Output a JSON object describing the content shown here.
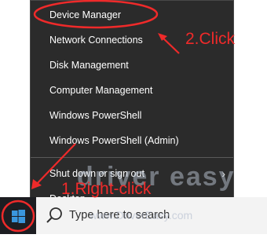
{
  "menu": {
    "items": [
      {
        "label": "Device Manager"
      },
      {
        "label": "Network Connections"
      },
      {
        "label": "Disk Management"
      },
      {
        "label": "Computer Management"
      },
      {
        "label": "Windows PowerShell"
      },
      {
        "label": "Windows PowerShell (Admin)"
      },
      {
        "label": "Shut down or sign out"
      },
      {
        "label": "Desktop"
      }
    ]
  },
  "taskbar": {
    "search_placeholder": "Type here to search",
    "start_icon": "windows-logo-icon",
    "search_icon": "search-icon"
  },
  "annotations": {
    "step1": "1.Right-click",
    "step2": "2.Click",
    "color": "#ef2a2a"
  },
  "watermark": {
    "brand": "driver easy",
    "url": "www.DriverEasy.com"
  }
}
